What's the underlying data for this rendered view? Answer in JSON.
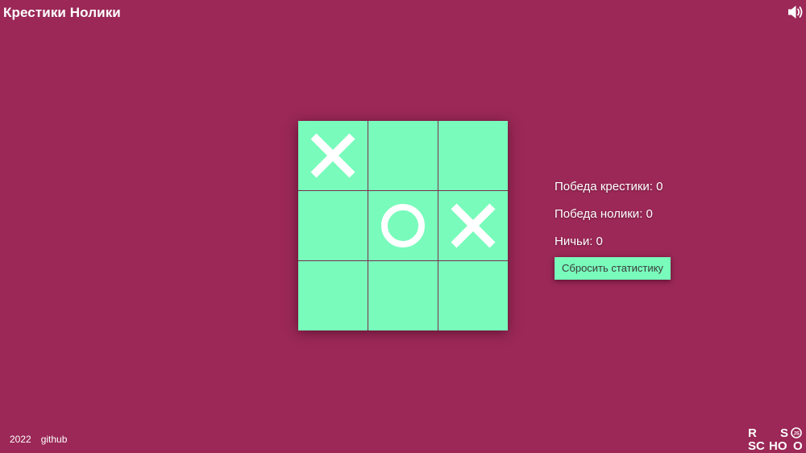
{
  "header": {
    "title": "Крестики Нолики",
    "sound_icon": "speaker-icon"
  },
  "board": {
    "cells": [
      "X",
      "",
      "",
      "",
      "O",
      "X",
      "",
      "",
      ""
    ]
  },
  "stats": {
    "x_wins": "Победа крестики: 0",
    "o_wins": "Победа нолики: 0",
    "draws": "Ничьи: 0",
    "reset_label": "Сбросить статистику"
  },
  "footer": {
    "year": "2022",
    "github_label": "github",
    "logo_icon": "rs-school-logo-icon",
    "logo_text": "RS SCHOOL JS"
  },
  "colors": {
    "background": "#9b2857",
    "cell": "#78fbbb",
    "mark": "#ffffff",
    "grid_line": "#7a3050"
  }
}
